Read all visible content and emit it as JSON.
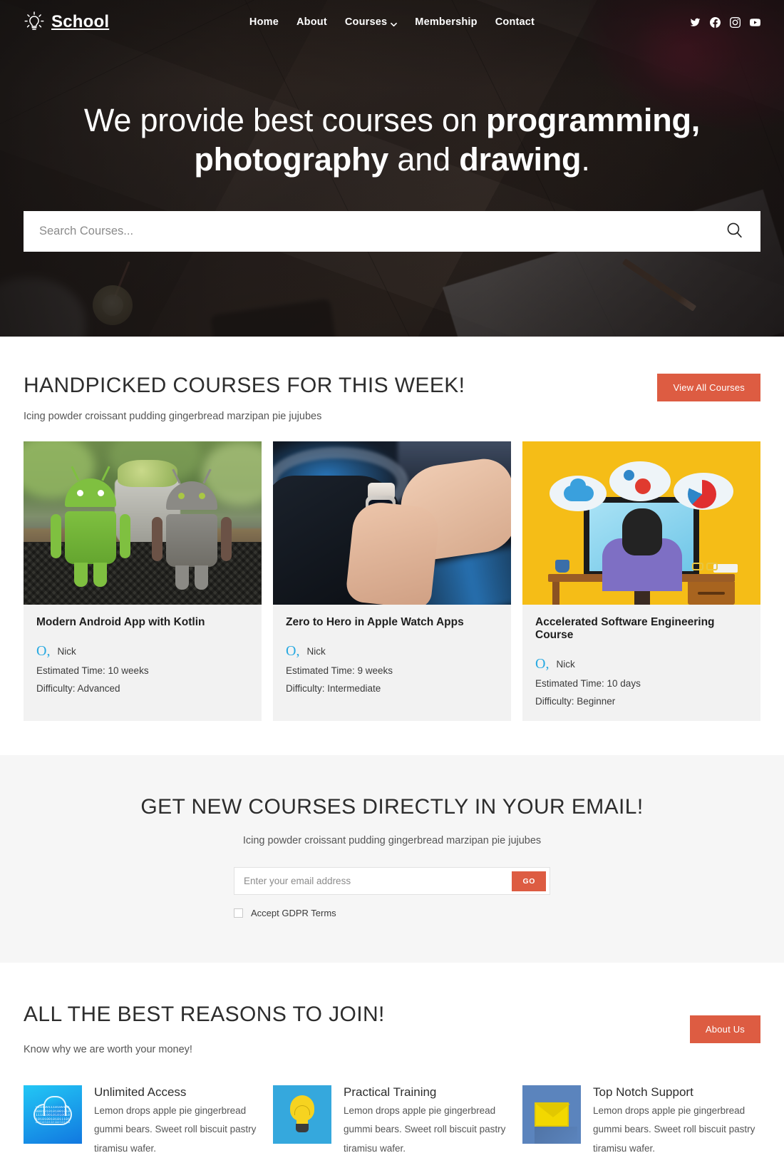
{
  "nav": {
    "brand": "School",
    "brand_icon": "lightbulb-icon",
    "links": [
      {
        "label": "Home",
        "has_caret": false
      },
      {
        "label": "About",
        "has_caret": false
      },
      {
        "label": "Courses",
        "has_caret": true
      },
      {
        "label": "Membership",
        "has_caret": false
      },
      {
        "label": "Contact",
        "has_caret": false
      }
    ],
    "socials": [
      "twitter-icon",
      "facebook-icon",
      "instagram-icon",
      "youtube-icon"
    ]
  },
  "hero": {
    "title_part1": "We provide best courses on ",
    "title_bold1": "programming,",
    "title_bold2": "photography",
    "title_part2": " and ",
    "title_bold3": "drawing",
    "title_period": ".",
    "search_placeholder": "Search Courses...",
    "search_value": "",
    "search_icon": "search-icon"
  },
  "courses": {
    "title": "HANDPICKED COURSES FOR THIS WEEK!",
    "subtitle": "Icing powder croissant pudding gingerbread marzipan pie jujubes",
    "button": "View All Courses",
    "items": [
      {
        "title": "Modern Android App with Kotlin",
        "author": "Nick",
        "time": "Estimated Time: 10 weeks",
        "difficulty": "Difficulty: Advanced",
        "image": "android-figures-photo"
      },
      {
        "title": "Zero to Hero in Apple Watch Apps",
        "author": "Nick",
        "time": "Estimated Time: 9 weeks",
        "difficulty": "Difficulty: Intermediate",
        "image": "smartwatch-in-car-photo"
      },
      {
        "title": "Accelerated Software Engineering Course",
        "author": "Nick",
        "time": "Estimated Time: 10 days",
        "difficulty": "Difficulty: Beginner",
        "image": "developer-at-desk-illustration"
      }
    ]
  },
  "newsletter": {
    "title": "GET NEW COURSES DIRECTLY IN YOUR EMAIL!",
    "subtitle": "Icing powder croissant pudding gingerbread marzipan pie jujubes",
    "email_placeholder": "Enter your email address",
    "email_value": "",
    "go_label": "GO",
    "gdpr_label": "Accept GDPR Terms",
    "gdpr_checked": false
  },
  "reasons": {
    "title": "ALL THE BEST REASONS TO JOIN!",
    "subtitle": "Know why we are worth your money!",
    "button": "About Us",
    "features": [
      {
        "title": "Unlimited Access",
        "text": "Lemon drops apple pie gingerbread gummi bears. Sweet roll biscuit pastry tiramisu wafer.",
        "icon": "binary-cloud-icon",
        "icon_color": "#1aa0ea"
      },
      {
        "title": "Practical Training",
        "text": "Lemon drops apple pie gingerbread gummi bears. Sweet roll biscuit pastry tiramisu wafer.",
        "icon": "lightbulb-icon",
        "icon_color": "#35a8dd"
      },
      {
        "title": "Top Notch Support",
        "text": "Lemon drops apple pie gingerbread gummi bears. Sweet roll biscuit pastry tiramisu wafer.",
        "icon": "envelope-icon",
        "icon_color": "#5b84bd"
      }
    ]
  },
  "colors": {
    "accent": "#dd5c42",
    "hero_bg": "#3a2f2a",
    "section_alt_bg": "#f6f6f6",
    "card_bg": "#f2f2f2",
    "broken_image_glyph": "#27a9e1"
  },
  "misc": {
    "broken_image_glyph": "O,",
    "binary_string": "0101001110100101000101010100101011101001010100101010100101011101001010101001010011101001010"
  }
}
